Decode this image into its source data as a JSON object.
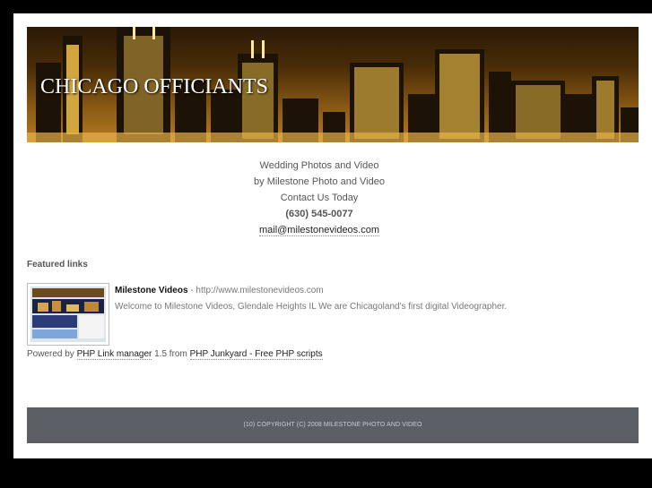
{
  "banner": {
    "title": "CHICAGO OFFICIANTS"
  },
  "contact": {
    "line1": "Wedding Photos and Video",
    "line2": "by Milestone Photo and Video",
    "line3": "Contact Us Today",
    "phone": "(630) 545-0077",
    "email": "mail@milestonevideos.com"
  },
  "featured": {
    "heading": "Featured links",
    "entries": [
      {
        "name": "Milestone Videos",
        "separator": " - ",
        "url": "http://www.milestonevideos.com",
        "description": "Welcome to Milestone Videos, Glendale Heights IL We are Chicagoland's first digital Videographer."
      }
    ]
  },
  "powered": {
    "prefix": "Powered by",
    "link1": "PHP Link manager",
    "middle": "1.5 from",
    "link2": "PHP Junkyard - Free PHP scripts"
  },
  "footer": {
    "copyright": "(10) COPYRIGHT (C) 2008 MILESTONE PHOTO AND VIDEO"
  },
  "colors": {
    "banner_night": "#2a1a06",
    "banner_glow": "#b37a22",
    "footer_bg": "#5c6066"
  }
}
